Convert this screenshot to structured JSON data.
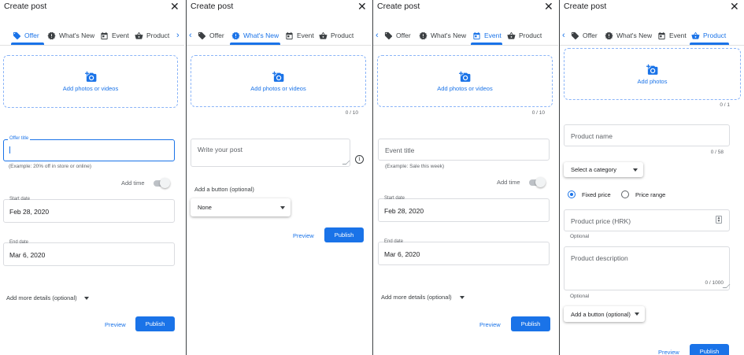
{
  "dialog_title": "Create post",
  "close_glyph": "✕",
  "tabs": {
    "offer": "Offer",
    "whats_new": "What's New",
    "event": "Event",
    "product": "Product"
  },
  "colors": {
    "accent": "#1a73e8",
    "divider": "#3c4043"
  },
  "offer_panel": {
    "upload_label": "Add photos or videos",
    "title_label": "Offer title",
    "title_value": "",
    "title_hint": "(Example: 20% off in store or online)",
    "add_time": "Add time",
    "start_label": "Start date",
    "start_value": "Feb 28, 2020",
    "end_label": "End date",
    "end_value": "Mar 6, 2020",
    "more_details": "Add more details (optional)",
    "preview": "Preview",
    "publish": "Publish"
  },
  "whatsnew_panel": {
    "upload_label": "Add photos or videos",
    "counter": "0 / 10",
    "post_placeholder": "Write your post",
    "button_label": "Add a button (optional)",
    "button_value": "None",
    "preview": "Preview",
    "publish": "Publish"
  },
  "event_panel": {
    "upload_label": "Add photos or videos",
    "counter": "0 / 10",
    "title_placeholder": "Event title",
    "title_hint": "(Example: Sale this week)",
    "add_time": "Add time",
    "start_label": "Start date",
    "start_value": "Feb 28, 2020",
    "end_label": "End date",
    "end_value": "Mar 6, 2020",
    "more_details": "Add more details (optional)",
    "preview": "Preview",
    "publish": "Publish"
  },
  "product_panel": {
    "upload_label": "Add photos",
    "upload_counter": "0 / 1",
    "name_placeholder": "Product name",
    "name_counter": "0 / 58",
    "category_value": "Select a category",
    "radio_fixed": "Fixed price",
    "radio_range": "Price range",
    "price_placeholder": "Product price (HRK)",
    "price_hint": "Optional",
    "desc_placeholder": "Product description",
    "desc_counter": "0 / 1000",
    "desc_hint": "Optional",
    "button_value": "Add a button (optional)",
    "preview": "Preview",
    "publish": "Publish"
  }
}
